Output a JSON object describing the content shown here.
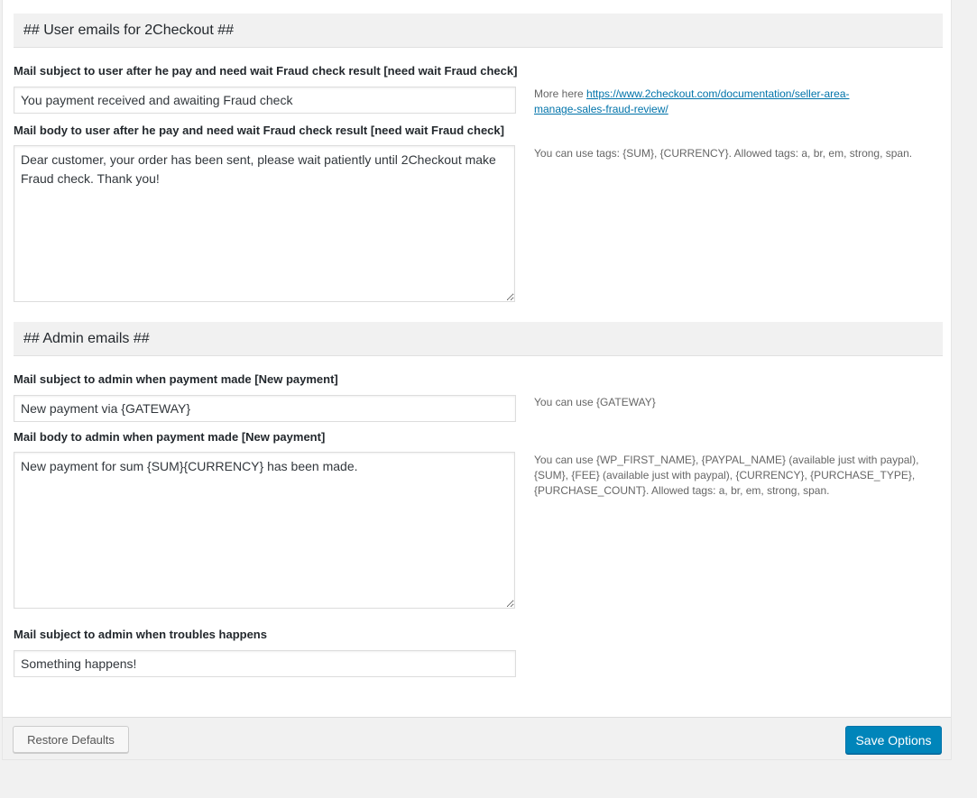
{
  "user_section": {
    "title": "## User emails for 2Checkout ##",
    "fraud_subject": {
      "label": "Mail subject to user after he pay and need wait Fraud check result [need wait Fraud check]",
      "value": "You payment received and awaiting Fraud check",
      "desc_prefix": "More here ",
      "link_line1": "https://www.2checkout.com/documentation/seller-area-",
      "link_line2": "manage-sales-fraud-review/"
    },
    "fraud_body": {
      "label": "Mail body to user after he pay and need wait Fraud check result [need wait Fraud check]",
      "value": "Dear customer, your order has been sent, please wait patiently until 2Checkout make Fraud check. Thank you!",
      "desc": "You can use tags: {SUM}, {CURRENCY}. Allowed tags: a, br, em, strong, span."
    }
  },
  "admin_section": {
    "title": "## Admin emails ##",
    "payment_subject": {
      "label": "Mail subject to admin when payment made [New payment]",
      "value": "New payment via {GATEWAY}",
      "desc": "You can use {GATEWAY}"
    },
    "payment_body": {
      "label": "Mail body to admin when payment made [New payment]",
      "value": "New payment for sum {SUM}{CURRENCY} has been made.",
      "desc": "You can use {WP_FIRST_NAME}, {PAYPAL_NAME} (available just with paypal), {SUM}, {FEE} (available just with paypal), {CURRENCY}, {PURCHASE_TYPE}, {PURCHASE_COUNT}. Allowed tags: a, br, em, strong, span."
    },
    "troubles_subject": {
      "label": "Mail subject to admin when troubles happens",
      "value": "Something happens!"
    }
  },
  "footer": {
    "restore_label": "Restore Defaults",
    "save_label": "Save Options"
  },
  "colors": {
    "primary": "#0085ba",
    "link": "#0073aa",
    "section_bg": "#f1f1f1"
  }
}
